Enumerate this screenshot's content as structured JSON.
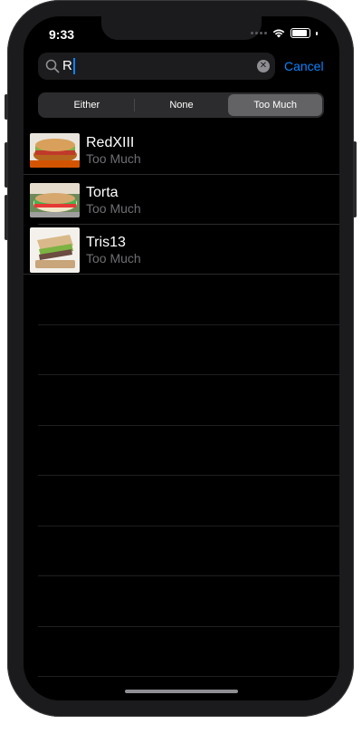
{
  "status_bar": {
    "time": "9:33"
  },
  "search": {
    "value": "R",
    "cancel_label": "Cancel"
  },
  "scope": {
    "segments": [
      "Either",
      "None",
      "Too Much"
    ],
    "selected": "Too Much"
  },
  "results": [
    {
      "title": "RedXIII",
      "subtitle": "Too Much",
      "image": "sandwich-photo"
    },
    {
      "title": "Torta",
      "subtitle": "Too Much",
      "image": "sandwich-photo"
    },
    {
      "title": "Tris13",
      "subtitle": "Too Much",
      "image": "sandwich-photo"
    }
  ],
  "colors": {
    "accent": "#0a84ff",
    "background": "#000000",
    "subtitle": "#6e6e73"
  }
}
